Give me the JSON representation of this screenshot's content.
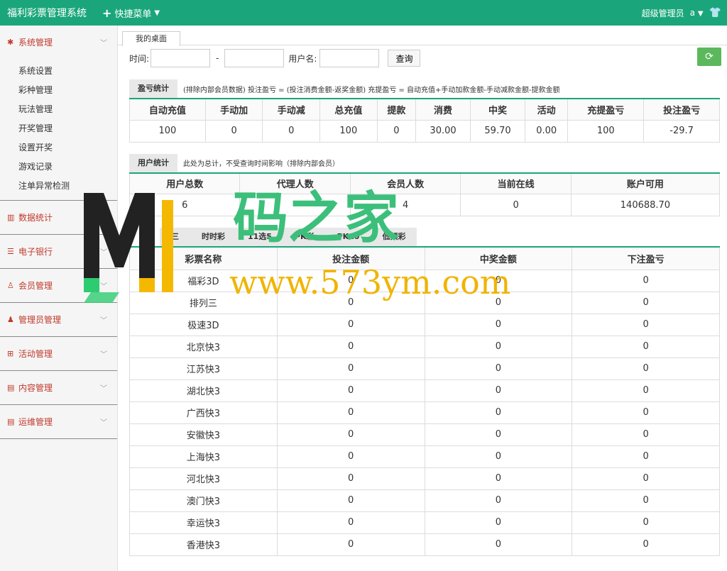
{
  "header": {
    "title": "福利彩票管理系统",
    "quick_menu": "快捷菜单",
    "user_role": "超级管理员",
    "user_name": "a"
  },
  "sidebar": {
    "groups": [
      {
        "label": "系统管理",
        "items": [
          "系统设置",
          "彩种管理",
          "玩法管理",
          "开奖管理",
          "设置开奖",
          "游戏记录",
          "注单异常检测"
        ]
      },
      {
        "label": "数据统计"
      },
      {
        "label": "电子银行"
      },
      {
        "label": "会员管理"
      },
      {
        "label": "管理员管理"
      },
      {
        "label": "活动管理"
      },
      {
        "label": "内容管理"
      },
      {
        "label": "运维管理"
      }
    ]
  },
  "tab": {
    "label": "我的桌面"
  },
  "filter": {
    "time_label": "时间:",
    "dash": "-",
    "user_label": "用户名:",
    "query": "查询"
  },
  "profit": {
    "title": "盈亏统计",
    "note": "(排除内部会员数据)  投注盈亏 = (投注消费金额-返奖金额)   充提盈亏 = 自动充值+手动加款金额-手动减款金额-提款金额",
    "headers": [
      "自动充值",
      "手动加",
      "手动减",
      "总充值",
      "提款",
      "消费",
      "中奖",
      "活动",
      "充提盈亏",
      "投注盈亏"
    ],
    "values": [
      "100",
      "0",
      "0",
      "100",
      "0",
      "30.00",
      "59.70",
      "0.00",
      "100",
      "-29.7"
    ]
  },
  "users": {
    "title": "用户统计",
    "note": "此处为总计，不受查询时间影响（排除内部会员）",
    "headers": [
      "用户总数",
      "代理人数",
      "会员人数",
      "当前在线",
      "账户可用"
    ],
    "values": [
      "6",
      "",
      "4",
      "0",
      "140688.70"
    ]
  },
  "lottery": {
    "tabs": [
      "福",
      "三",
      "时时彩",
      "11选5",
      "PK彩",
      "PK10",
      "低频彩"
    ],
    "headers": [
      "彩票名称",
      "投注金额",
      "中奖金额",
      "下注盈亏"
    ],
    "rows": [
      [
        "福彩3D",
        "0",
        "0",
        "0"
      ],
      [
        "排列三",
        "0",
        "0",
        "0"
      ],
      [
        "极速3D",
        "0",
        "0",
        "0"
      ],
      [
        "北京快3",
        "0",
        "0",
        "0"
      ],
      [
        "江苏快3",
        "0",
        "0",
        "0"
      ],
      [
        "湖北快3",
        "0",
        "0",
        "0"
      ],
      [
        "广西快3",
        "0",
        "0",
        "0"
      ],
      [
        "安徽快3",
        "0",
        "0",
        "0"
      ],
      [
        "上海快3",
        "0",
        "0",
        "0"
      ],
      [
        "河北快3",
        "0",
        "0",
        "0"
      ],
      [
        "澳门快3",
        "0",
        "0",
        "0"
      ],
      [
        "幸运快3",
        "0",
        "0",
        "0"
      ],
      [
        "香港快3",
        "0",
        "0",
        "0"
      ]
    ]
  },
  "watermark": {
    "cn": "码之家",
    "url": "www.573ym.com"
  }
}
